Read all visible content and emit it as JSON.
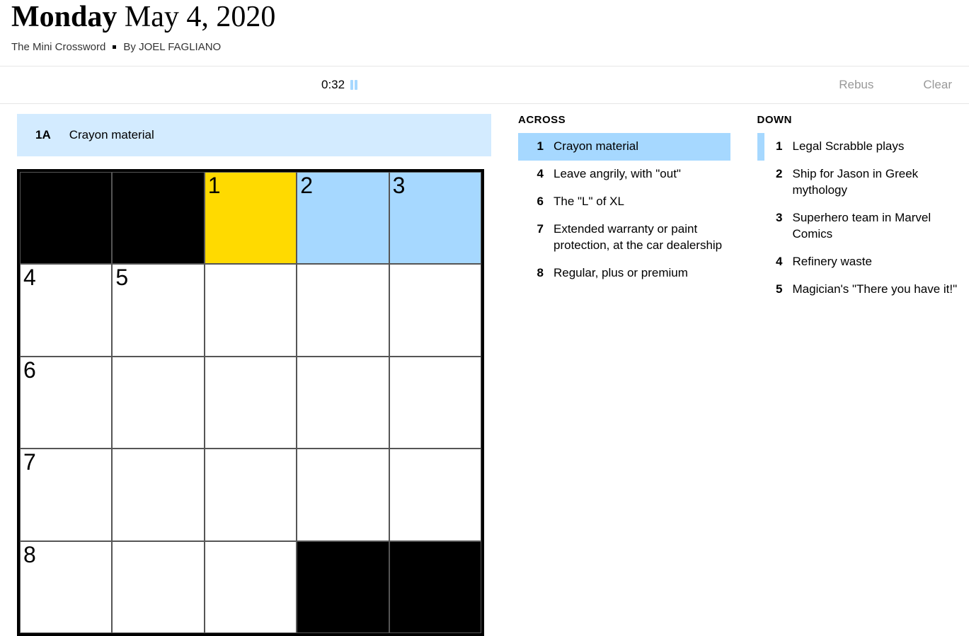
{
  "header": {
    "day": "Monday",
    "date": "May 4, 2020",
    "puzzle_name": "The Mini Crossword",
    "byline_prefix": "By",
    "author": "JOEL FAGLIANO"
  },
  "toolbar": {
    "timer": "0:32",
    "rebus_label": "Rebus",
    "clear_label": "Clear"
  },
  "current_clue": {
    "number": "1A",
    "text": "Crayon material"
  },
  "grid": {
    "size": 5,
    "cells": [
      {
        "r": 0,
        "c": 0,
        "black": true
      },
      {
        "r": 0,
        "c": 1,
        "black": true
      },
      {
        "r": 0,
        "c": 2,
        "num": "1",
        "cursor": true
      },
      {
        "r": 0,
        "c": 3,
        "num": "2",
        "hl": true
      },
      {
        "r": 0,
        "c": 4,
        "num": "3",
        "hl": true
      },
      {
        "r": 1,
        "c": 0,
        "num": "4"
      },
      {
        "r": 1,
        "c": 1,
        "num": "5"
      },
      {
        "r": 1,
        "c": 2
      },
      {
        "r": 1,
        "c": 3
      },
      {
        "r": 1,
        "c": 4
      },
      {
        "r": 2,
        "c": 0,
        "num": "6"
      },
      {
        "r": 2,
        "c": 1
      },
      {
        "r": 2,
        "c": 2
      },
      {
        "r": 2,
        "c": 3
      },
      {
        "r": 2,
        "c": 4
      },
      {
        "r": 3,
        "c": 0,
        "num": "7"
      },
      {
        "r": 3,
        "c": 1
      },
      {
        "r": 3,
        "c": 2
      },
      {
        "r": 3,
        "c": 3
      },
      {
        "r": 3,
        "c": 4
      },
      {
        "r": 4,
        "c": 0,
        "num": "8"
      },
      {
        "r": 4,
        "c": 1
      },
      {
        "r": 4,
        "c": 2
      },
      {
        "r": 4,
        "c": 3,
        "black": true
      },
      {
        "r": 4,
        "c": 4,
        "black": true
      }
    ]
  },
  "clues": {
    "across_label": "ACROSS",
    "down_label": "DOWN",
    "across": [
      {
        "num": "1",
        "text": "Crayon material",
        "active": true
      },
      {
        "num": "4",
        "text": "Leave angrily, with \"out\""
      },
      {
        "num": "6",
        "text": "The \"L\" of XL"
      },
      {
        "num": "7",
        "text": "Extended warranty or paint protection, at the car dealership"
      },
      {
        "num": "8",
        "text": "Regular, plus or premium"
      }
    ],
    "down": [
      {
        "num": "1",
        "text": "Legal Scrabble plays",
        "secondary": true
      },
      {
        "num": "2",
        "text": "Ship for Jason in Greek mythology"
      },
      {
        "num": "3",
        "text": "Superhero team in Marvel Comics"
      },
      {
        "num": "4",
        "text": "Refinery waste"
      },
      {
        "num": "5",
        "text": "Magician's \"There you have it!\""
      }
    ]
  }
}
